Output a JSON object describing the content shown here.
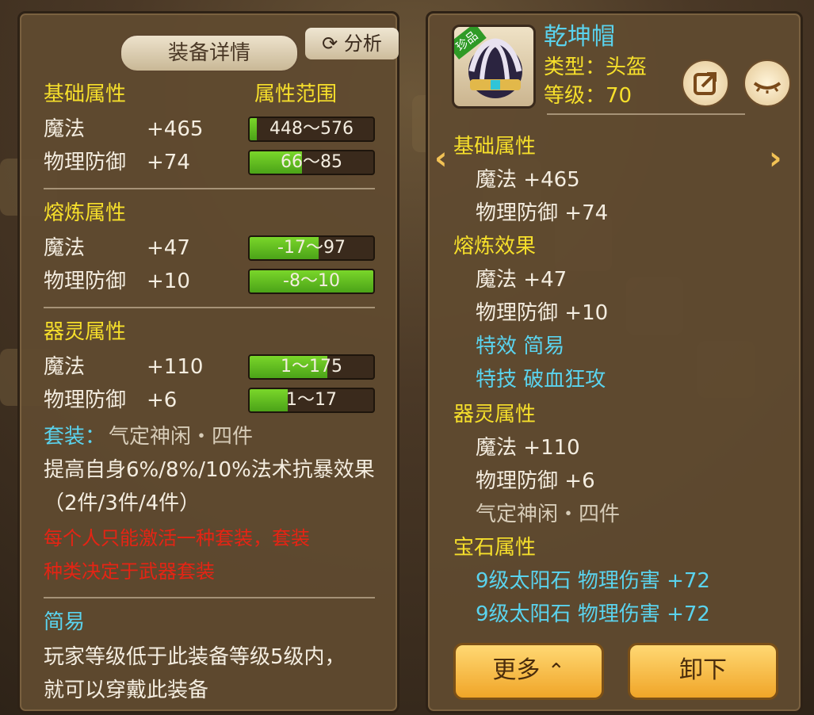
{
  "left_panel": {
    "title": "装备详情",
    "analyze_label": "分析",
    "base_header": "基础属性",
    "range_header": "属性范围",
    "base_attrs": [
      {
        "name": "魔法",
        "value": "+465",
        "range": "448～576",
        "fill": 0.06
      },
      {
        "name": "物理防御",
        "value": "+74",
        "range": "66～85",
        "fill": 0.42
      }
    ],
    "refine_header": "熔炼属性",
    "refine_attrs": [
      {
        "name": "魔法",
        "value": "+47",
        "range": "-17～97",
        "fill": 0.56
      },
      {
        "name": "物理防御",
        "value": "+10",
        "range": "-8～10",
        "fill": 1.0
      }
    ],
    "spirit_header": "器灵属性",
    "spirit_attrs": [
      {
        "name": "魔法",
        "value": "+110",
        "range": "1～175",
        "fill": 0.63
      },
      {
        "name": "物理防御",
        "value": "+6",
        "range": "1～17",
        "fill": 0.31
      }
    ],
    "set_label": "套装：",
    "set_name": "气定神闲・四件",
    "set_desc_1": "提高自身6%/8%/10%法术抗暴效果",
    "set_desc_2": "（2件/3件/4件）",
    "warning_1": "每个人只能激活一种套装，套装",
    "warning_2": "种类决定于武器套装",
    "special_title": "简易",
    "special_desc_1": "玩家等级低于此装备等级5级内，",
    "special_desc_2": "就可以穿戴此装备"
  },
  "right_panel": {
    "rare_badge": "珍品",
    "item_name": "乾坤帽",
    "type_line": "类型：头盔",
    "level_line": "等级：70",
    "base_header": "基础属性",
    "base_attrs": [
      {
        "name": "魔法",
        "value": "+465"
      },
      {
        "name": "物理防御",
        "value": "+74"
      }
    ],
    "refine_header": "熔炼效果",
    "refine_attrs": [
      {
        "name": "魔法",
        "value": "+47"
      },
      {
        "name": "物理防御",
        "value": "+10"
      }
    ],
    "special_effect": "特效  简易",
    "special_skill": "特技  破血狂攻",
    "spirit_header": "器灵属性",
    "spirit_attrs": [
      {
        "name": "魔法",
        "value": "+110"
      },
      {
        "name": "物理防御",
        "value": "+6"
      }
    ],
    "set_name": "气定神闲・四件",
    "gem_header": "宝石属性",
    "gems": [
      {
        "name": "9级太阳石",
        "attr": "物理伤害",
        "value": "+72"
      },
      {
        "name": "9级太阳石",
        "attr": "物理伤害",
        "value": "+72"
      }
    ],
    "more_button": "更多",
    "unequip_button": "卸下"
  },
  "colors": {
    "gold": "#f6df2b",
    "cyan": "#5ad3ee",
    "red": "#e52414",
    "bar_green": "#6cc324"
  }
}
